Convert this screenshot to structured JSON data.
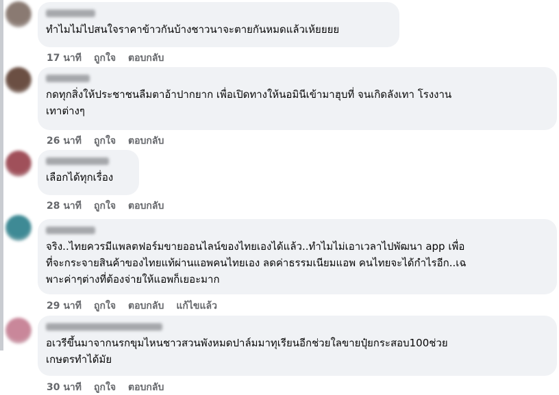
{
  "comments": [
    {
      "avatar_color": "#8a7a72",
      "text_lines": [
        "ทำไมไม่ไปสนใจราคาข้าวกันบ้างชาวนาจะตายกันหมดแล้วเห้ยยยย"
      ],
      "time": "17 นาที",
      "like": "ถูกใจ",
      "reply": "ตอบกลับ",
      "edited": ""
    },
    {
      "avatar_color": "#6b4f43",
      "text_lines": [
        "กดทุกสิ่งให้ประชาชนลืมตาอ้าปากยาก เพื่อเปิดทางให้นอมินีเข้ามาฮุบที่ จนเกิดลังเทา โรงงาน",
        "เทาต่างๆ"
      ],
      "time": "26 นาที",
      "like": "ถูกใจ",
      "reply": "ตอบกลับ",
      "edited": ""
    },
    {
      "avatar_color": "#a0505a",
      "text_lines": [
        "เลือกได้ทุกเรื่อง"
      ],
      "time": "28 นาที",
      "like": "ถูกใจ",
      "reply": "ตอบกลับ",
      "edited": ""
    },
    {
      "avatar_color": "#3e8a95",
      "text_lines": [
        "จริง..ไทยควรมีแพลตฟอร์มขายออนไลน์ของไทยเองได้แล้ว..ทำไมไม่เอาเวลาไปพัฒนา app เพื่อ",
        "ที่จะกระจายสินค้าของไทยแท้ผ่านแอพคนไทยเอง ลดค่าธรรมเนียมแอพ คนไทยจะได้กำไรอีก..เฉ",
        "พาะค่าๆต่างที่ต้องจ่ายให้แอพก็เยอะมาก"
      ],
      "time": "29 นาที",
      "like": "ถูกใจ",
      "reply": "ตอบกลับ",
      "edited": "แก้ไขแล้ว"
    },
    {
      "avatar_color": "#c9879a",
      "text_lines": [
        "อเวรีขึ้นมาจากนรกขุมไหนชาวสวนพังหมดปาล์มมาทุเรียนอีกช่วยใลขายปุ๋ยกระสอบ100ช่วย",
        "เกษตรทำได้มัย"
      ],
      "time": "30 นาที",
      "like": "ถูกใจ",
      "reply": "ตอบกลับ",
      "edited": ""
    }
  ]
}
